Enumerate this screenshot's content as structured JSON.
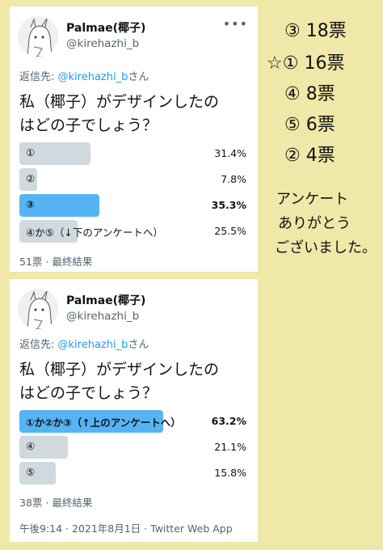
{
  "tweets": [
    {
      "user": {
        "display_name": "Palmae(椰子)",
        "handle": "@kirehazhi_b"
      },
      "reply_prefix": "返信先: ",
      "reply_to": "@kirehazhi_b",
      "reply_suffix": "さん",
      "question_line1": "私（椰子）がデザインしたの",
      "question_line2": "はどの子でしょう？",
      "options": [
        {
          "label": "①",
          "percent_text": "31.4%",
          "percent": 31.4,
          "winner": false
        },
        {
          "label": "②",
          "percent_text": "7.8%",
          "percent": 7.8,
          "winner": false
        },
        {
          "label": "③",
          "percent_text": "35.3%",
          "percent": 35.3,
          "winner": true
        },
        {
          "label": "④か⑤（↓下のアンケートへ）",
          "percent_text": "25.5%",
          "percent": 25.5,
          "winner": false
        }
      ],
      "result_text": "51票 · 最終結果"
    },
    {
      "user": {
        "display_name": "Palmae(椰子)",
        "handle": "@kirehazhi_b"
      },
      "reply_prefix": "返信先: ",
      "reply_to": "@kirehazhi_b",
      "reply_suffix": "さん",
      "question_line1": "私（椰子）がデザインしたの",
      "question_line2": "はどの子でしょう？",
      "options": [
        {
          "label": "①か②か③（↑上のアンケートへ）",
          "percent_text": "63.2%",
          "percent": 63.2,
          "winner": true
        },
        {
          "label": "④",
          "percent_text": "21.1%",
          "percent": 21.1,
          "winner": false
        },
        {
          "label": "⑤",
          "percent_text": "15.8%",
          "percent": 15.8,
          "winner": false
        }
      ],
      "result_text": "38票 · 最終結果",
      "timestamp": "午後9:14 · 2021年8月1日 · Twitter Web App"
    }
  ],
  "handwritten": {
    "tally": [
      {
        "prefix": "",
        "num": "③",
        "votes": "18票"
      },
      {
        "prefix": "☆",
        "num": "①",
        "votes": "16票"
      },
      {
        "prefix": "",
        "num": "④",
        "votes": "8票"
      },
      {
        "prefix": "",
        "num": "⑤",
        "votes": "6票"
      },
      {
        "prefix": "",
        "num": "②",
        "votes": "4票"
      }
    ],
    "thanks_line1": "アンケート",
    "thanks_line2": "ありがとう",
    "thanks_line3": "ございました。"
  }
}
